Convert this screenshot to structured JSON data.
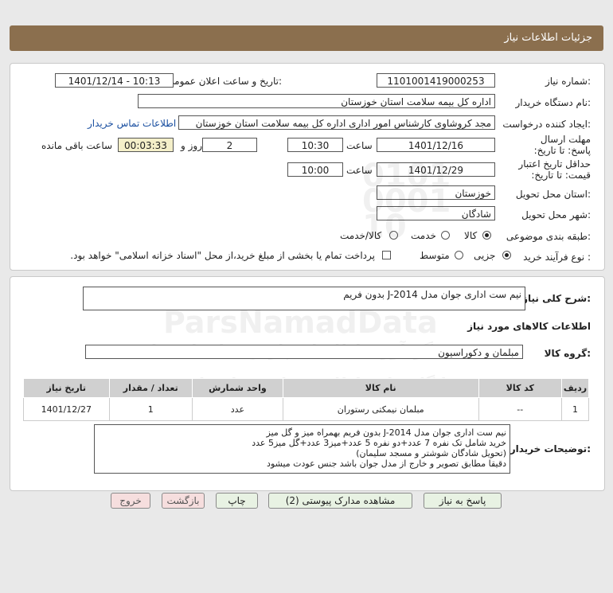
{
  "page_title": "جزئیات اطلاعات نیاز",
  "fields": {
    "need_number_label": "شماره نیاز:",
    "need_number": "1101001419000253",
    "announce_label": "تاریخ و ساعت اعلان عمومی:",
    "announce_value": "1401/12/14 - 10:13",
    "buyer_org_label": "نام دستگاه خریدار:",
    "buyer_org": "اداره کل بیمه سلامت استان خوزستان",
    "requester_label": "ایجاد کننده درخواست:",
    "requester": "مجد کروشاوی کارشناس امور اداری اداره کل بیمه سلامت استان خوزستان",
    "contact_link": "اطلاعات تماس خریدار",
    "deadline_label": "مهلت ارسال پاسخ: تا تاریخ:",
    "deadline_date": "1401/12/16",
    "time_label": "ساعت",
    "deadline_time": "10:30",
    "days_value": "2",
    "days_label": "روز و",
    "remaining_time": "00:03:33",
    "remaining_label": "ساعت باقی مانده",
    "validity_label": "حداقل تاریخ اعتبار قیمت: تا تاریخ:",
    "validity_date": "1401/12/29",
    "validity_time": "10:00",
    "province_label": "استان محل تحویل:",
    "province": "خوزستان",
    "city_label": "شهر محل تحویل:",
    "city": "شادگان",
    "category_label": "طبقه بندی موضوعی:",
    "category_options": [
      "کالا",
      "خدمت",
      "کالا/خدمت"
    ],
    "category_selected": "کالا",
    "process_label": "نوع فرآیند خرید :",
    "process_options": [
      "جزیی",
      "متوسط"
    ],
    "process_selected": "جزیی",
    "payment_note": "پرداخت تمام یا بخشی از مبلغ خرید،از محل \"اسناد خزانه اسلامی\" خواهد بود."
  },
  "summary": {
    "label": "شرح کلی نیاز:",
    "value": "نیم ست اداری جوان مدل J-2014 بدون فریم"
  },
  "goods": {
    "section_title": "اطلاعات کالاهای مورد نیاز",
    "group_label": "گروه کالا:",
    "group_value": "مبلمان و دکوراسیون",
    "columns": [
      "ردیف",
      "کد کالا",
      "نام کالا",
      "واحد شمارش",
      "تعداد / مقدار",
      "تاریخ نیاز"
    ],
    "rows": [
      {
        "row": "1",
        "code": "--",
        "name": "مبلمان نیمکتی رستوران",
        "unit": "عدد",
        "qty": "1",
        "date": "1401/12/27"
      }
    ]
  },
  "buyer_notes": {
    "label": "توضیحات خریدار:",
    "text": "نیم ست اداری جوان مدل J-2014 بدون فریم بهمراه میز و گل میز\nخرید شامل تک نفره 7 عدد+دو نفره 5 عدد+میز3 عدد+گل میز5 عدد\n(تحویل شادگان شوشتر و مسجد سلیمان)\nدقیقا مطابق تصویر و خارج از مدل جوان باشد جنس عودت میشود"
  },
  "buttons": {
    "reply": "پاسخ به نیاز",
    "attachments": "مشاهده مدارک پیوستی (2)",
    "print": "چاپ",
    "back": "بازگشت",
    "exit": "خروج"
  },
  "watermark": {
    "brand": "ParsNamadData",
    "line1": "گردآوری اطلاعات پارس نماد داده ها",
    "line2": "پایگاه جامع اطلاع رسانی مناقصات",
    "phone": "۰۲۱-۸۸۳۴۹۶۷۰",
    "digits": "0101 0001 10"
  },
  "colors": {
    "header": "#8b6f4e",
    "link": "#1a4fa0",
    "highlight": "#f4efc9",
    "button_green": "#e8f2e3",
    "button_pink": "#f6dede"
  }
}
